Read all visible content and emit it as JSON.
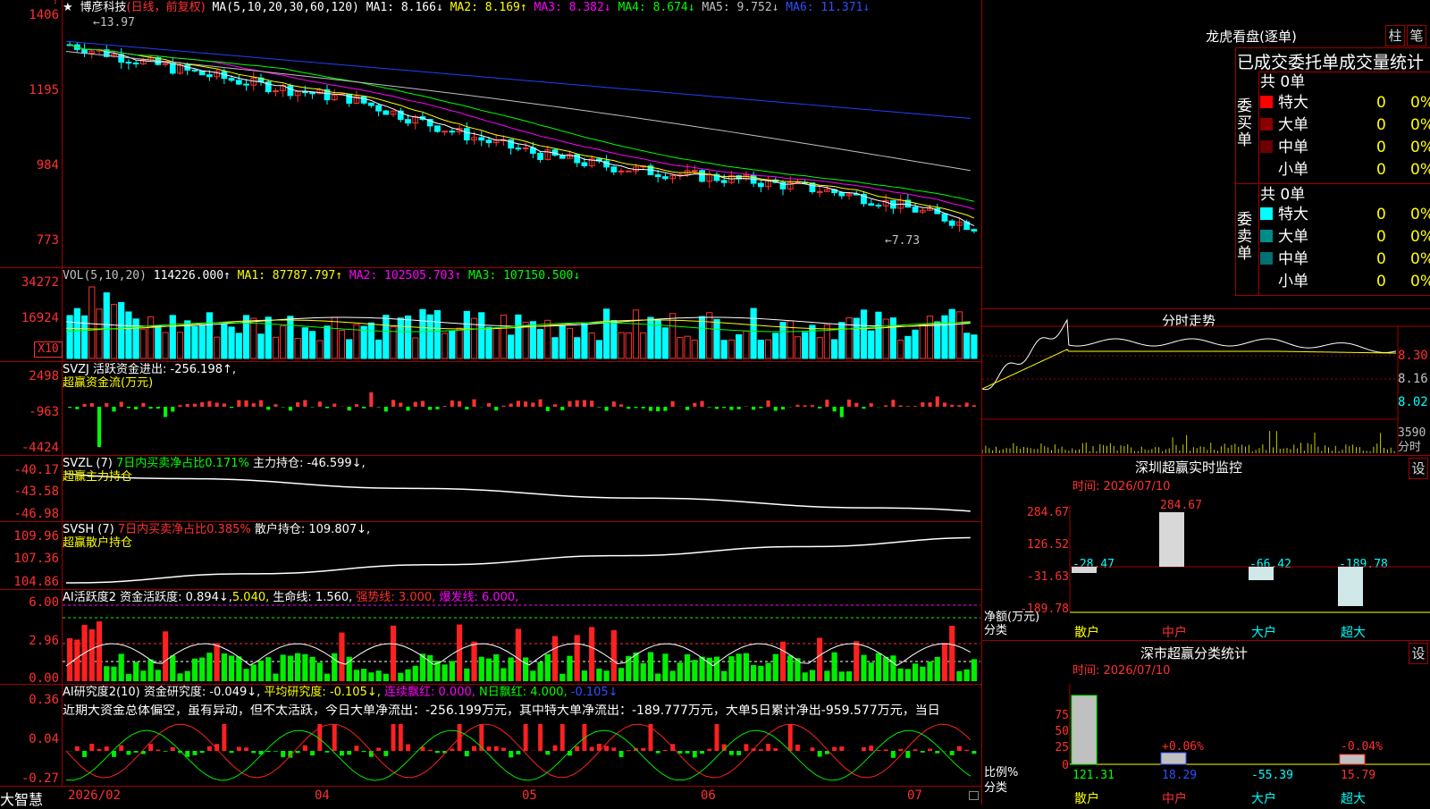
{
  "stock": {
    "star": "★",
    "name": "博彦科技",
    "mode": "(日线，前复权)"
  },
  "main_legend": {
    "label": "MA(5,10,20,30,60,120)",
    "ma1": "MA1: 8.166↓",
    "ma2": "MA2: 8.169↑",
    "ma3": "MA3: 8.382↓",
    "ma4": "MA4: 8.674↓",
    "ma5": "MA5: 9.752↓",
    "ma6": "MA6: 11.371↓"
  },
  "main_axis": [
    "1406",
    "1195",
    "984",
    "773"
  ],
  "main_annotations": {
    "high": "←13.97",
    "low": "←7.73"
  },
  "vol": {
    "label": "VOL(5,10,20)",
    "value": "114226.000↑",
    "ma1": "MA1: 87787.797↑",
    "ma2": "MA2: 102505.703↑",
    "ma3": "MA3: 107150.500↓",
    "axis": [
      "34272",
      "16924"
    ],
    "unit": "X10"
  },
  "svzj": {
    "label": "SVZJ  活跃资金进出: -256.198↑,",
    "sub": "超赢资金流(万元)",
    "axis": [
      "2498",
      "-963",
      "-4424"
    ]
  },
  "svzl": {
    "label": "SVZL (7)",
    "desc": "7日内买卖净占比0.171%",
    "hold": "主力持仓: -46.599↓,",
    "sub": "超赢主力持仓",
    "axis": [
      "-40.17",
      "-43.58",
      "-46.98"
    ]
  },
  "svsh": {
    "label": "SVSH (7)",
    "desc": "7日内买卖净占比0.385%",
    "hold": "散户持仓: 109.807↓,",
    "sub": "超赢散户持仓",
    "axis": [
      "109.96",
      "107.36",
      "104.86"
    ]
  },
  "ai1": {
    "label": "AI活跃度2",
    "act": "资金活跃度: 0.894↓,",
    "v2": "5.040,",
    "life": "生命线: 1.560,",
    "strong": "强势线: 3.000,",
    "burst": "爆发线: 6.000,",
    "axis": [
      "6.00",
      "2.96",
      "0.00"
    ]
  },
  "ai2": {
    "label": "AI研究度2(10)",
    "res": "资金研究度: -0.049↓,",
    "avg": "平均研究度: -0.105↓,",
    "red": "连续飘红: 0.000,",
    "nday": "N日飘红: 4.000,",
    "last": "-0.105↓",
    "text": "近期大资金总体偏空，虽有异动，但不太活跃，今日大单净流出：-256.199万元，其中特大单净流出：-189.777万元，大单5日累计净出-959.577万元，当日",
    "axis": [
      "0.36",
      "0.04",
      "-0.27"
    ]
  },
  "xaxis": {
    "brand": "大智慧",
    "labels": [
      "2026/02",
      "04",
      "05",
      "06",
      "07"
    ]
  },
  "right": {
    "title": "龙虎看盘(逐单)",
    "btn1": "柱",
    "btn2": "笔",
    "header": "已成交委托单成交量统计",
    "buy": {
      "label": "委买单",
      "total": "共 0单",
      "rows": [
        {
          "name": "特大",
          "v": "0",
          "p": "0%",
          "color": "#ff0000"
        },
        {
          "name": "大单",
          "v": "0",
          "p": "0%",
          "color": "#8b0000"
        },
        {
          "name": "中单",
          "v": "0",
          "p": "0%",
          "color": "#6b0000"
        },
        {
          "name": "小单",
          "v": "0",
          "p": "0%",
          "color": "#000000"
        }
      ]
    },
    "sell": {
      "label": "委卖单",
      "total": "共 0单",
      "rows": [
        {
          "name": "特大",
          "v": "0",
          "p": "0%",
          "color": "#00ffff"
        },
        {
          "name": "大单",
          "v": "0",
          "p": "0%",
          "color": "#008b8b"
        },
        {
          "name": "中单",
          "v": "0",
          "p": "0%",
          "color": "#007070"
        },
        {
          "name": "小单",
          "v": "0",
          "p": "0%",
          "color": "#000000"
        }
      ]
    },
    "intraday": {
      "title": "分时走势",
      "axis": [
        "8.30",
        "8.16",
        "8.02"
      ],
      "vol": "3590",
      "vol_lbl": "分时"
    },
    "monitor": {
      "title": "深圳超赢实时监控",
      "btn": "设",
      "date": "时间: 2026/07/10",
      "axis": [
        "284.67",
        "126.52",
        "-31.63",
        "-189.78"
      ],
      "unit": "净额(万元)",
      "cat_lbl": "分类",
      "cats": [
        "散户",
        "中户",
        "大户",
        "超大"
      ],
      "vals": [
        "-28.47",
        "284.67",
        "-66.42",
        "-189.78"
      ]
    },
    "stats": {
      "title": "深市超赢分类统计",
      "btn": "设",
      "date": "时间: 2026/07/10",
      "axis": [
        "75",
        "50",
        "25",
        "0"
      ],
      "unit": "比例%",
      "cat_lbl": "分类",
      "cats": [
        "散户",
        "中户",
        "大户",
        "超大"
      ],
      "vals": [
        "121.31",
        "18.29",
        "-55.39",
        "15.79"
      ],
      "pcts": [
        "+0.06%",
        "-0.04%"
      ]
    }
  },
  "chart_data": [
    {
      "type": "candlestick",
      "title": "博彦科技",
      "series": [
        {
          "name": "MA1",
          "last": 8.166
        },
        {
          "name": "MA2",
          "last": 8.169
        },
        {
          "name": "MA3",
          "last": 8.382
        },
        {
          "name": "MA4",
          "last": 8.674
        },
        {
          "name": "MA5",
          "last": 9.752
        },
        {
          "name": "MA6",
          "last": 11.371
        }
      ],
      "high": 13.97,
      "low": 7.73,
      "yticks": [
        "1406",
        "1195",
        "984",
        "773"
      ],
      "xticks": [
        "2026/02",
        "04",
        "05",
        "06",
        "07"
      ]
    },
    {
      "type": "bar",
      "title": "VOL",
      "last": 114226.0,
      "ma": [
        87787.797,
        102505.703,
        107150.5
      ]
    },
    {
      "type": "bar",
      "title": "超赢资金流(万元)",
      "last": -256.198
    },
    {
      "type": "line",
      "title": "超赢主力持仓",
      "last": -46.599
    },
    {
      "type": "line",
      "title": "超赢散户持仓",
      "last": 109.807
    },
    {
      "type": "bar",
      "title": "AI活跃度2",
      "last": 0.894
    },
    {
      "type": "bar",
      "title": "AI研究度2(10)",
      "last": -0.049
    },
    {
      "type": "bar",
      "title": "深圳超赢实时监控",
      "categories": [
        "散户",
        "中户",
        "大户",
        "超大"
      ],
      "values": [
        -28.47,
        284.67,
        -66.42,
        -189.78
      ]
    },
    {
      "type": "bar",
      "title": "深市超赢分类统计",
      "categories": [
        "散户",
        "中户",
        "大户",
        "超大"
      ],
      "values": [
        121.31,
        18.29,
        -55.39,
        15.79
      ]
    }
  ]
}
